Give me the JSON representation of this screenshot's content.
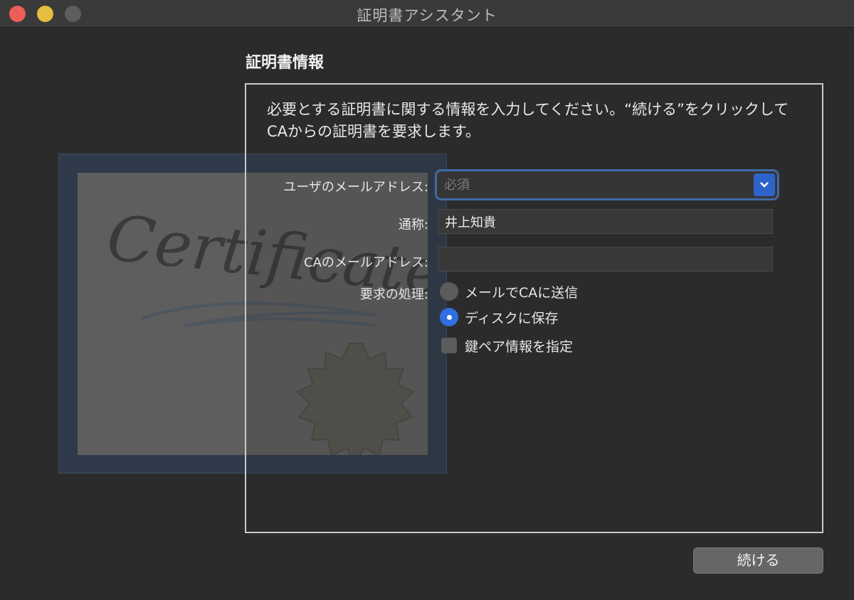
{
  "window": {
    "title": "証明書アシスタント"
  },
  "section": {
    "title": "証明書情報",
    "description": "必要とする証明書に関する情報を入力してください。“続ける”をクリックしてCAからの証明書を要求します。"
  },
  "illustration": {
    "text": "Certificate"
  },
  "form": {
    "email": {
      "label": "ユーザのメールアドレス:",
      "placeholder": "必須",
      "value": ""
    },
    "common_name": {
      "label": "通称:",
      "value": "井上知貴"
    },
    "ca_email": {
      "label": "CAのメールアドレス:",
      "value": ""
    },
    "request": {
      "label": "要求の処理:",
      "options": [
        {
          "label": "メールでCAに送信",
          "selected": false
        },
        {
          "label": "ディスクに保存",
          "selected": true
        }
      ]
    },
    "key_pair": {
      "label": "鍵ペア情報を指定",
      "checked": false
    }
  },
  "buttons": {
    "continue": "続ける"
  },
  "colors": {
    "accent": "#2f6fe0",
    "focus_ring": "#3f6aa5"
  }
}
